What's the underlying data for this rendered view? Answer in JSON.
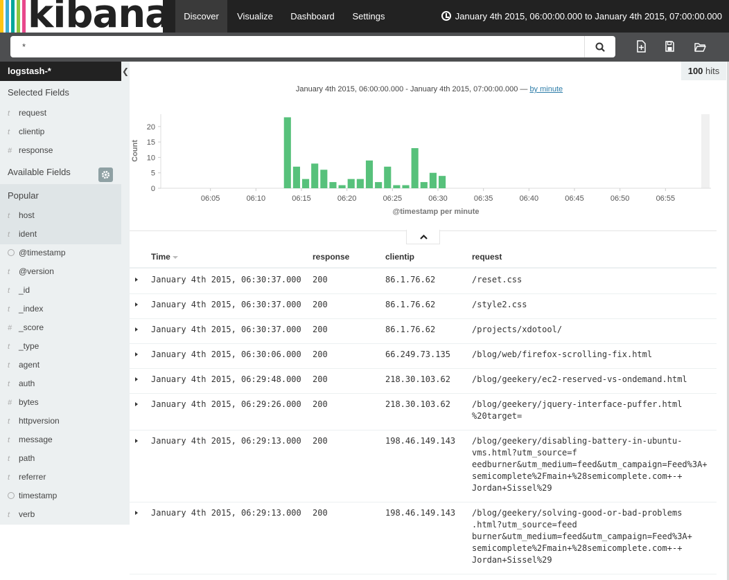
{
  "app": {
    "brand": "kibana",
    "brand_colors": [
      "#e8488b",
      "#3caed2",
      "#fec514",
      "#00a69b"
    ]
  },
  "nav": {
    "tabs": [
      {
        "label": "Discover",
        "active": true
      },
      {
        "label": "Visualize",
        "active": false
      },
      {
        "label": "Dashboard",
        "active": false
      },
      {
        "label": "Settings",
        "active": false
      }
    ],
    "time_range": "January 4th 2015, 06:00:00.000 to January 4th 2015, 07:00:00.000"
  },
  "search": {
    "query": "*",
    "icons": {
      "search": "search-icon",
      "new": "new-search-icon",
      "save": "save-icon",
      "open": "open-folder-icon"
    }
  },
  "sidebar": {
    "index_pattern": "logstash-*",
    "selected_heading": "Selected Fields",
    "selected_fields": [
      {
        "name": "request",
        "type": "t"
      },
      {
        "name": "clientip",
        "type": "t"
      },
      {
        "name": "response",
        "type": "#"
      }
    ],
    "available_heading": "Available Fields",
    "popular_heading": "Popular",
    "popular_fields": [
      {
        "name": "host",
        "type": "t"
      },
      {
        "name": "ident",
        "type": "t"
      }
    ],
    "other_fields": [
      {
        "name": "@timestamp",
        "type": "clock"
      },
      {
        "name": "@version",
        "type": "t"
      },
      {
        "name": "_id",
        "type": "t"
      },
      {
        "name": "_index",
        "type": "t"
      },
      {
        "name": "_score",
        "type": "#"
      },
      {
        "name": "_type",
        "type": "t"
      },
      {
        "name": "agent",
        "type": "t"
      },
      {
        "name": "auth",
        "type": "t"
      },
      {
        "name": "bytes",
        "type": "#"
      },
      {
        "name": "httpversion",
        "type": "t"
      },
      {
        "name": "message",
        "type": "t"
      },
      {
        "name": "path",
        "type": "t"
      },
      {
        "name": "referrer",
        "type": "t"
      },
      {
        "name": "timestamp",
        "type": "clock"
      },
      {
        "name": "verb",
        "type": "t"
      }
    ]
  },
  "hits": {
    "count": "100",
    "label": "hits"
  },
  "chart_header": {
    "range": "January 4th 2015, 06:00:00.000 - January 4th 2015, 07:00:00.000 — ",
    "interval": "by minute"
  },
  "chart_data": {
    "type": "bar",
    "xlabel": "@timestamp per minute",
    "ylabel": "Count",
    "ylim": [
      0,
      24
    ],
    "yticks": [
      0,
      5,
      10,
      15,
      20
    ],
    "xticks": [
      "06:05",
      "06:10",
      "06:15",
      "06:20",
      "06:25",
      "06:30",
      "06:35",
      "06:40",
      "06:45",
      "06:50",
      "06:55"
    ],
    "xtick_minutes": [
      5,
      10,
      15,
      20,
      25,
      30,
      35,
      40,
      45,
      50,
      55
    ],
    "xlim_minutes": [
      0,
      60
    ],
    "bar_color": "#57c17b",
    "minutes": [
      13,
      14,
      15,
      16,
      17,
      18,
      19,
      20,
      21,
      22,
      23,
      24,
      25,
      26,
      27,
      28,
      29,
      30
    ],
    "values": [
      23,
      7,
      3,
      8,
      6,
      2,
      1,
      3,
      3,
      9,
      2,
      7,
      1,
      1,
      13,
      2,
      5,
      4
    ]
  },
  "table": {
    "columns": [
      "Time",
      "response",
      "clientip",
      "request"
    ],
    "rows": [
      {
        "time": "January 4th 2015, 06:30:37.000",
        "response": "200",
        "clientip": "86.1.76.62",
        "request": "/reset.css"
      },
      {
        "time": "January 4th 2015, 06:30:37.000",
        "response": "200",
        "clientip": "86.1.76.62",
        "request": "/style2.css"
      },
      {
        "time": "January 4th 2015, 06:30:37.000",
        "response": "200",
        "clientip": "86.1.76.62",
        "request": "/projects/xdotool/"
      },
      {
        "time": "January 4th 2015, 06:30:06.000",
        "response": "200",
        "clientip": "66.249.73.135",
        "request": "/blog/web/firefox-scrolling-fix.html"
      },
      {
        "time": "January 4th 2015, 06:29:48.000",
        "response": "200",
        "clientip": "218.30.103.62",
        "request": "/blog/geekery/ec2-reserved-vs-ondemand.html"
      },
      {
        "time": "January 4th 2015, 06:29:26.000",
        "response": "200",
        "clientip": "218.30.103.62",
        "request": "/blog/geekery/jquery-interface-puffer.html\n%20target="
      },
      {
        "time": "January 4th 2015, 06:29:13.000",
        "response": "200",
        "clientip": "198.46.149.143",
        "request": "/blog/geekery/disabling-battery-in-ubuntu-\nvms.html?utm_source=f\needburner&utm_medium=feed&utm_campaign=Feed%3A+\nsemicomplete%2Fmain+%28semicomplete.com+-+\nJordan+Sissel%29"
      },
      {
        "time": "January 4th 2015, 06:29:13.000",
        "response": "200",
        "clientip": "198.46.149.143",
        "request": "/blog/geekery/solving-good-or-bad-problems\n.html?utm_source=feed\nburner&utm_medium=feed&utm_campaign=Feed%3A+\nsemicomplete%2Fmain+%28semicomplete.com+-+\nJordan+Sissel%29"
      }
    ]
  }
}
